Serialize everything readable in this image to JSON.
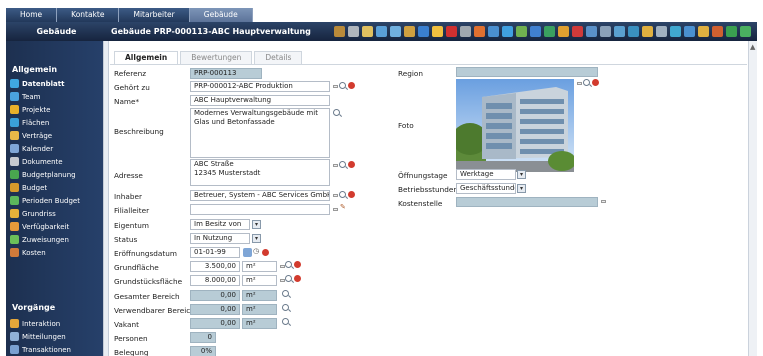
{
  "top_tabs": [
    {
      "label": "Home",
      "active": false
    },
    {
      "label": "Kontakte",
      "active": false
    },
    {
      "label": "Mitarbeiter",
      "active": false
    },
    {
      "label": "Gebäude",
      "active": true
    }
  ],
  "header": {
    "section": "Gebäude",
    "title": "Gebäude PRP-000113-ABC Hauptverwaltung"
  },
  "sidebar": {
    "group1": "Allgemein",
    "items1": [
      {
        "label": "Datenblatt",
        "active": true,
        "color": "#3fa7e0"
      },
      {
        "label": "Team",
        "active": false,
        "color": "#4aa3df"
      },
      {
        "label": "Projekte",
        "active": false,
        "color": "#e8b02a"
      },
      {
        "label": "Flächen",
        "active": false,
        "color": "#3aa0d8"
      },
      {
        "label": "Verträge",
        "active": false,
        "color": "#e7b848"
      },
      {
        "label": "Kalender",
        "active": false,
        "color": "#7fa6d6"
      },
      {
        "label": "Dokumente",
        "active": false,
        "color": "#c5c9cf"
      },
      {
        "label": "Budgetplanung",
        "active": false,
        "color": "#49a64f"
      },
      {
        "label": "Budget",
        "active": false,
        "color": "#d59a2b"
      },
      {
        "label": "Perioden Budget",
        "active": false,
        "color": "#5cb85c"
      },
      {
        "label": "Grundriss",
        "active": false,
        "color": "#e6b23a"
      },
      {
        "label": "Verfügbarkeit",
        "active": false,
        "color": "#e89a3a"
      },
      {
        "label": "Zuweisungen",
        "active": false,
        "color": "#6bbf59"
      },
      {
        "label": "Kosten",
        "active": false,
        "color": "#d07a3a"
      }
    ],
    "group2": "Vorgänge",
    "items2": [
      {
        "label": "Interaktion",
        "active": false,
        "color": "#e3a63a"
      },
      {
        "label": "Mitteilungen",
        "active": false,
        "color": "#8fb0d6"
      },
      {
        "label": "Transaktionen",
        "active": false,
        "color": "#7aa0d0"
      }
    ]
  },
  "tabs": [
    {
      "label": "Allgemein",
      "active": true
    },
    {
      "label": "Bewertungen",
      "active": false
    },
    {
      "label": "Details",
      "active": false
    }
  ],
  "form": {
    "referenz": {
      "label": "Referenz",
      "value": "PRP-000113"
    },
    "gehoert_zu": {
      "label": "Gehört zu",
      "value": "PRP-000012-ABC Produktion"
    },
    "name": {
      "label": "Name*",
      "value": "ABC Hauptverwaltung"
    },
    "beschreibung": {
      "label": "Beschreibung",
      "value": "Modernes Verwaltungsgebäude mit Glas und Betonfassade"
    },
    "adresse": {
      "label": "Adresse",
      "line1": "ABC Straße",
      "line2": "12345 Musterstadt"
    },
    "inhaber": {
      "label": "Inhaber",
      "value": "Betreuer, System - ABC Services GmbH"
    },
    "filialleiter": {
      "label": "Filialleiter",
      "value": ""
    },
    "eigentum": {
      "label": "Eigentum",
      "value": "Im Besitz von"
    },
    "status": {
      "label": "Status",
      "value": "In Nutzung"
    },
    "eroeffnungsdatum": {
      "label": "Eröffnungsdatum",
      "value": "01-01-99"
    },
    "grundflaeche": {
      "label": "Grundfläche",
      "value": "3.500,00",
      "unit": "m²"
    },
    "grundstuecksflaeche": {
      "label": "Grundstücksfläche",
      "value": "8.000,00",
      "unit": "m²"
    },
    "gesamter_bereich": {
      "label": "Gesamter Bereich",
      "value": "0,00",
      "unit": "m²"
    },
    "verwendbarer_bereich": {
      "label": "Verwendbarer Bereich",
      "value": "0,00",
      "unit": "m²"
    },
    "vakant": {
      "label": "Vakant",
      "value": "0,00",
      "unit": "m²"
    },
    "personen": {
      "label": "Personen",
      "value": "0"
    },
    "belegung": {
      "label": "Belegung",
      "value": "0%"
    }
  },
  "right": {
    "region": {
      "label": "Region",
      "value": ""
    },
    "foto": {
      "label": "Foto"
    },
    "oeffnungstage": {
      "label": "Öffnungstage",
      "value": "Werktage"
    },
    "betriebsstunden": {
      "label": "Betriebsstunden",
      "value": "Geschäftsstunde"
    },
    "kostenstelle": {
      "label": "Kostenstelle",
      "value": ""
    }
  },
  "toolbar_icons": [
    {
      "name": "print-icon",
      "color": "#b98a3a"
    },
    {
      "name": "calendar-icon",
      "color": "#b0b6bd"
    },
    {
      "name": "edit-icon",
      "color": "#e0c060"
    },
    {
      "name": "world-icon",
      "color": "#5aa0d8"
    },
    {
      "name": "tag-icon",
      "color": "#70b0e0"
    },
    {
      "name": "people-icon",
      "color": "#d0a040"
    },
    {
      "name": "list-icon",
      "color": "#3a7fd0"
    },
    {
      "name": "folder-icon",
      "color": "#f0c040"
    },
    {
      "name": "stop-icon",
      "color": "#d03030"
    },
    {
      "name": "tools-icon",
      "color": "#a0a8b0"
    },
    {
      "name": "paint-icon",
      "color": "#e07030"
    },
    {
      "name": "pen-icon",
      "color": "#4a8fd0"
    },
    {
      "name": "chart-icon",
      "color": "#40a0e0"
    },
    {
      "name": "user-icon",
      "color": "#70b050"
    },
    {
      "name": "doc-icon",
      "color": "#4080d0"
    },
    {
      "name": "refresh-icon",
      "color": "#3aa060"
    },
    {
      "name": "pie-icon",
      "color": "#e0a030"
    },
    {
      "name": "cancel-icon",
      "color": "#d03a3a"
    },
    {
      "name": "report-icon",
      "color": "#5a90c8"
    },
    {
      "name": "mail-icon",
      "color": "#8aa0b8"
    },
    {
      "name": "link-icon",
      "color": "#5aa0d0"
    },
    {
      "name": "graph-icon",
      "color": "#3a90c0"
    },
    {
      "name": "money-icon",
      "color": "#e0b040"
    },
    {
      "name": "group-icon",
      "color": "#a0b0c0"
    },
    {
      "name": "map-icon",
      "color": "#40a8d0"
    },
    {
      "name": "help-icon",
      "color": "#4a90d0"
    },
    {
      "name": "pause-icon",
      "color": "#e0b040"
    },
    {
      "name": "key-icon",
      "color": "#d06030"
    },
    {
      "name": "tool2-icon",
      "color": "#3aa050"
    },
    {
      "name": "globe-icon",
      "color": "#4ab060"
    }
  ]
}
